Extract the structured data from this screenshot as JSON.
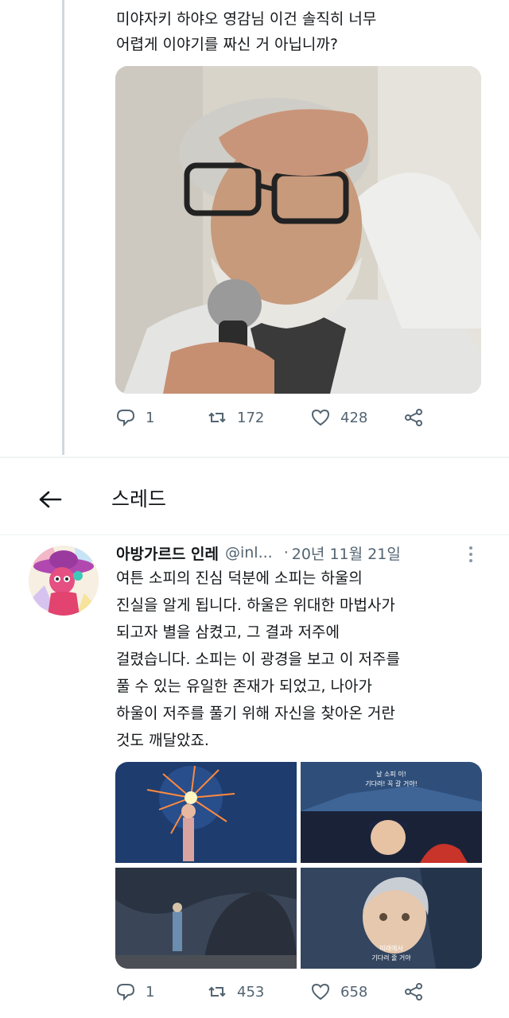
{
  "top_tweet": {
    "text_line1": "미야자키 하야오 영감님 이건 솔직히 너무",
    "text_line2": "어렵게 이야기를 짜신 거 아닙니까?",
    "photo_icon": "photo-of-elderly-man-with-microphone",
    "stats": {
      "replies": "1",
      "retweets": "172",
      "likes": "428"
    }
  },
  "header": {
    "back_icon": "arrow-left-icon",
    "title": "스레드"
  },
  "thread_tweet": {
    "display_name": "아방가르드 인레",
    "handle": "@inl...",
    "separator": "·",
    "date": "20년 11월 21일",
    "lines": [
      "여튼 소피의 진심 덕분에 소피는 하울의",
      "진실을 알게 됩니다. 하울은 위대한 마법사가",
      "되고자 별을 삼켰고, 그 결과 저주에",
      "걸렸습니다. 소피는 이 광경을 보고 이 저주를",
      "풀 수 있는 유일한 존재가 되었고, 나아가",
      "하울이 저주를 풀기 위해 자신을 찾아온 거란",
      "것도 깨달았죠."
    ],
    "media": [
      {
        "icon": "anime-still-fireworks"
      },
      {
        "icon": "anime-still-subtitled",
        "subtitle1": "날 소피 이!",
        "subtitle2": "기다려! 꼭 갈 거야!"
      },
      {
        "icon": "anime-still-dark-forest"
      },
      {
        "icon": "anime-still-girl-closeup",
        "subtitle1": "미래에서",
        "subtitle2": "기다려 줄 거야"
      }
    ],
    "stats": {
      "replies": "1",
      "retweets": "453",
      "likes": "658"
    }
  },
  "colors": {
    "text": "#14171a",
    "muted": "#536471",
    "thread_line": "#cfd9de"
  }
}
